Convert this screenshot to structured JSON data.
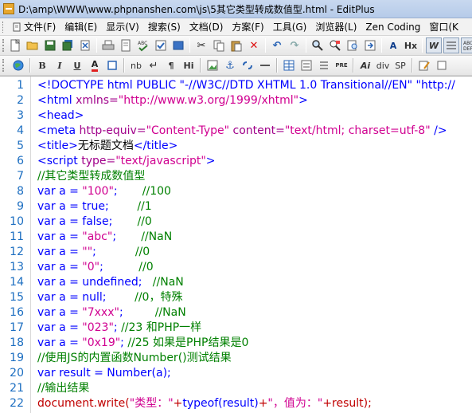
{
  "window": {
    "title": "D:\\amp\\WWW\\www.phpnanshen.com\\js\\5其它类型转成数值型.html - EditPlus"
  },
  "menubar": {
    "items": [
      {
        "label": "文件(F)",
        "icon": "file-icon"
      },
      {
        "label": "编辑(E)"
      },
      {
        "label": "显示(V)"
      },
      {
        "label": "搜索(S)"
      },
      {
        "label": "文档(D)"
      },
      {
        "label": "方案(F)"
      },
      {
        "label": "工具(G)"
      },
      {
        "label": "浏览器(L)"
      },
      {
        "label": "Zen Coding"
      },
      {
        "label": "窗口(K"
      }
    ]
  },
  "toolbar2": {
    "bold": "B",
    "italic": "I",
    "underline": "U",
    "font_color": "A",
    "nbsp": "nb",
    "paragraph": "¶",
    "heading": "Hi",
    "italic_html": "Ai",
    "heading_x": "Hx",
    "div": "div",
    "span": "SP",
    "pre": "PRE"
  },
  "colors": {
    "tag": "#0000ff",
    "attribute": "#a0008a",
    "string": "#d00090",
    "comment": "#008000",
    "keyword": "#0000ff",
    "js_call": "#c00000",
    "line_number": "#1c6ec1"
  },
  "editor": {
    "lines": [
      {
        "n": "1",
        "parts": [
          {
            "c": "t",
            "v": "<!DOCTYPE html PUBLIC \"-//W3C//DTD XHTML 1.0 Transitional//EN\" \"http://"
          }
        ]
      },
      {
        "n": "2",
        "parts": [
          {
            "c": "t",
            "v": "<html "
          },
          {
            "c": "a",
            "v": "xmlns="
          },
          {
            "c": "s",
            "v": "\"http://www.w3.org/1999/xhtml\""
          },
          {
            "c": "t",
            "v": ">"
          }
        ]
      },
      {
        "n": "3",
        "parts": [
          {
            "c": "t",
            "v": "<head>"
          }
        ]
      },
      {
        "n": "4",
        "parts": [
          {
            "c": "t",
            "v": "<meta "
          },
          {
            "c": "a",
            "v": "http-equiv="
          },
          {
            "c": "s",
            "v": "\"Content-Type\""
          },
          {
            "c": "a",
            "v": " content="
          },
          {
            "c": "s",
            "v": "\"text/html; charset=utf-8\""
          },
          {
            "c": "t",
            "v": " />"
          }
        ]
      },
      {
        "n": "5",
        "parts": [
          {
            "c": "t",
            "v": "<title>"
          },
          {
            "c": "tx",
            "v": "无标题文档"
          },
          {
            "c": "t",
            "v": "</title>"
          }
        ]
      },
      {
        "n": "6",
        "parts": [
          {
            "c": "t",
            "v": "<script "
          },
          {
            "c": "a",
            "v": "type="
          },
          {
            "c": "s",
            "v": "\"text/javascript\""
          },
          {
            "c": "t",
            "v": ">"
          }
        ]
      },
      {
        "n": "7",
        "parts": [
          {
            "c": "c",
            "v": "//其它类型转成数值型"
          }
        ]
      },
      {
        "n": "8",
        "parts": [
          {
            "c": "k",
            "v": "var a = "
          },
          {
            "c": "s",
            "v": "\"100\""
          },
          {
            "c": "k",
            "v": ";       "
          },
          {
            "c": "c",
            "v": "//100"
          }
        ]
      },
      {
        "n": "9",
        "parts": [
          {
            "c": "k",
            "v": "var a = true;        "
          },
          {
            "c": "c",
            "v": "//1"
          }
        ]
      },
      {
        "n": "10",
        "parts": [
          {
            "c": "k",
            "v": "var a = false;       "
          },
          {
            "c": "c",
            "v": "//0"
          }
        ]
      },
      {
        "n": "11",
        "parts": [
          {
            "c": "k",
            "v": "var a = "
          },
          {
            "c": "s",
            "v": "\"abc\""
          },
          {
            "c": "k",
            "v": ";       "
          },
          {
            "c": "c",
            "v": "//NaN"
          }
        ]
      },
      {
        "n": "12",
        "parts": [
          {
            "c": "k",
            "v": "var a = "
          },
          {
            "c": "s",
            "v": "\"\""
          },
          {
            "c": "k",
            "v": ";           "
          },
          {
            "c": "c",
            "v": "//0"
          }
        ]
      },
      {
        "n": "13",
        "parts": [
          {
            "c": "k",
            "v": "var a = "
          },
          {
            "c": "s",
            "v": "\"0\""
          },
          {
            "c": "k",
            "v": ";          "
          },
          {
            "c": "c",
            "v": "//0"
          }
        ]
      },
      {
        "n": "14",
        "parts": [
          {
            "c": "k",
            "v": "var a = undefined;   "
          },
          {
            "c": "c",
            "v": "//NaN"
          }
        ]
      },
      {
        "n": "15",
        "parts": [
          {
            "c": "k",
            "v": "var a = null;        "
          },
          {
            "c": "c",
            "v": "//0，特殊"
          }
        ]
      },
      {
        "n": "16",
        "parts": [
          {
            "c": "k",
            "v": "var a = "
          },
          {
            "c": "s",
            "v": "\"7xxx\""
          },
          {
            "c": "k",
            "v": ";         "
          },
          {
            "c": "c",
            "v": "//NaN"
          }
        ]
      },
      {
        "n": "17",
        "parts": [
          {
            "c": "k",
            "v": "var a = "
          },
          {
            "c": "s",
            "v": "\"023\""
          },
          {
            "c": "k",
            "v": "; "
          },
          {
            "c": "c",
            "v": "//23 和PHP一样"
          }
        ]
      },
      {
        "n": "18",
        "parts": [
          {
            "c": "k",
            "v": "var a = "
          },
          {
            "c": "s",
            "v": "\"0x19\""
          },
          {
            "c": "k",
            "v": "; "
          },
          {
            "c": "c",
            "v": "//25 如果是PHP结果是0"
          }
        ]
      },
      {
        "n": "19",
        "parts": [
          {
            "c": "c",
            "v": "//使用JS的内置函数Number()测试结果"
          }
        ]
      },
      {
        "n": "20",
        "parts": [
          {
            "c": "k",
            "v": "var result = Number(a);"
          }
        ]
      },
      {
        "n": "21",
        "parts": [
          {
            "c": "c",
            "v": "//输出结果"
          }
        ]
      },
      {
        "n": "22",
        "parts": [
          {
            "c": "r",
            "v": "document.write("
          },
          {
            "c": "s",
            "v": "\"类型：\""
          },
          {
            "c": "r",
            "v": "+"
          },
          {
            "c": "k",
            "v": "typeof(result)"
          },
          {
            "c": "r",
            "v": "+"
          },
          {
            "c": "s",
            "v": "\"，值为：\""
          },
          {
            "c": "r",
            "v": "+result);"
          }
        ]
      }
    ]
  }
}
